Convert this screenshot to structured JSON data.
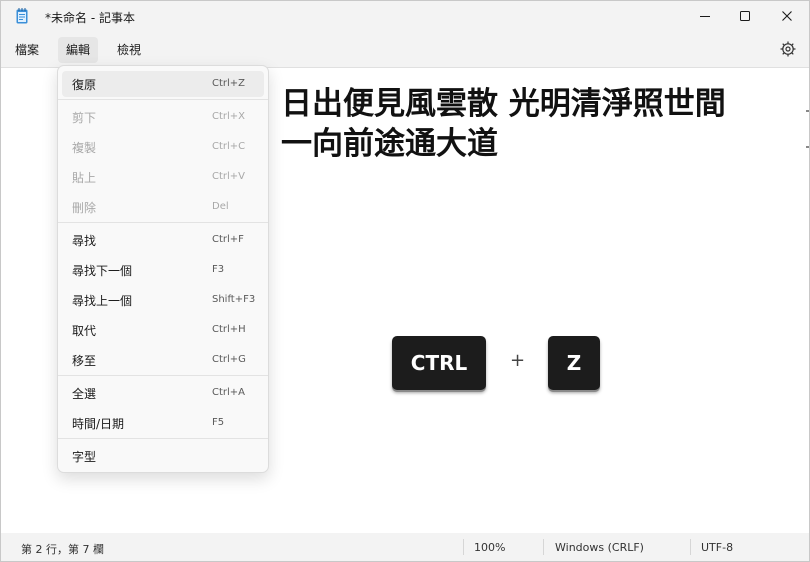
{
  "window": {
    "title": "*未命名 - 記事本"
  },
  "menubar": {
    "items": [
      "檔案",
      "編輯",
      "檢視"
    ],
    "active": "編輯"
  },
  "edit_menu": {
    "items": [
      {
        "label": "復原",
        "shortcut": "Ctrl+Z",
        "enabled": true,
        "highlighted": true
      },
      {
        "label": "剪下",
        "shortcut": "Ctrl+X",
        "enabled": false
      },
      {
        "label": "複製",
        "shortcut": "Ctrl+C",
        "enabled": false
      },
      {
        "label": "貼上",
        "shortcut": "Ctrl+V",
        "enabled": false
      },
      {
        "label": "刪除",
        "shortcut": "Del",
        "enabled": false
      },
      {
        "label": "尋找",
        "shortcut": "Ctrl+F",
        "enabled": true
      },
      {
        "label": "尋找下一個",
        "shortcut": "F3",
        "enabled": true
      },
      {
        "label": "尋找上一個",
        "shortcut": "Shift+F3",
        "enabled": true
      },
      {
        "label": "取代",
        "shortcut": "Ctrl+H",
        "enabled": true
      },
      {
        "label": "移至",
        "shortcut": "Ctrl+G",
        "enabled": true
      },
      {
        "label": "全選",
        "shortcut": "Ctrl+A",
        "enabled": true
      },
      {
        "label": "時間/日期",
        "shortcut": "F5",
        "enabled": true
      },
      {
        "label": "字型",
        "shortcut": "",
        "enabled": true
      }
    ]
  },
  "editor": {
    "line1": "日出便見風雲散 光明清淨照世間",
    "line2": "一向前途通大道"
  },
  "keyboard_graphic": {
    "key1": "CTRL",
    "plus": "+",
    "key2": "Z"
  },
  "status": {
    "position": "第 2 行，第 7 欄",
    "zoom": "100%",
    "line_ending": "Windows (CRLF)",
    "encoding": "UTF-8"
  },
  "icons": {
    "app": "notepad-icon",
    "settings": "gear-icon",
    "minimize": "minimize-icon",
    "maximize": "maximize-icon",
    "close": "close-icon"
  },
  "colors": {
    "key_background": "#1c1c1c",
    "menu_highlight": "#ececec",
    "disabled_text": "#a8a8a8"
  }
}
